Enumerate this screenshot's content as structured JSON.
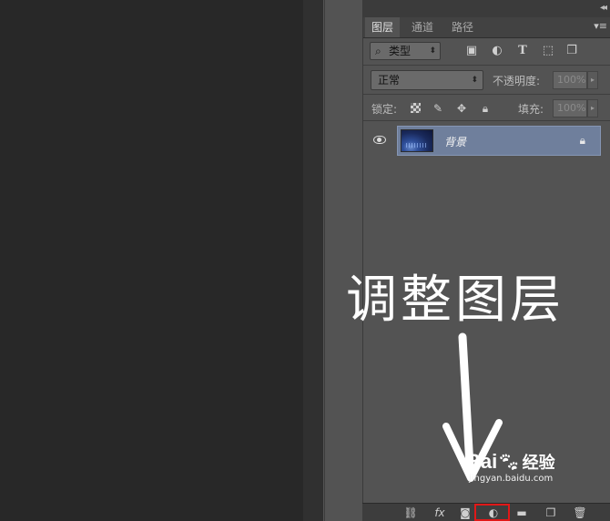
{
  "panel": {
    "tabs": [
      {
        "label": "图层",
        "active": true
      },
      {
        "label": "通道",
        "active": false
      },
      {
        "label": "路径",
        "active": false
      }
    ],
    "filter": {
      "kind_label": "类型",
      "filter_icons": [
        "image-filter-icon",
        "adjustment-filter-icon",
        "type-filter-icon",
        "shape-filter-icon",
        "smart-object-filter-icon"
      ]
    },
    "blend": {
      "mode": "正常",
      "opacity_label": "不透明度:",
      "opacity_value": "100%"
    },
    "lock": {
      "label": "锁定:",
      "fill_label": "填充:",
      "fill_value": "100%"
    },
    "layers": [
      {
        "name": "背景",
        "visible": true,
        "locked": true,
        "selected": true
      }
    ],
    "bottom_icons": [
      "link-layers-icon",
      "fx-icon",
      "add-mask-icon",
      "adjustment-layer-icon",
      "new-group-icon",
      "new-layer-icon",
      "delete-layer-icon"
    ],
    "bottom_fx_text": "fx"
  },
  "annotation": {
    "text": "调整图层",
    "color": "#ffffff"
  },
  "watermark": {
    "logo": "Bai",
    "logo_suffix": "经验",
    "url": "jingyan.baidu.com"
  },
  "colors": {
    "selection": "#6f7f9c",
    "highlight_box": "#e01818",
    "panel_bg": "#535353",
    "canvas_bg": "#282828"
  }
}
